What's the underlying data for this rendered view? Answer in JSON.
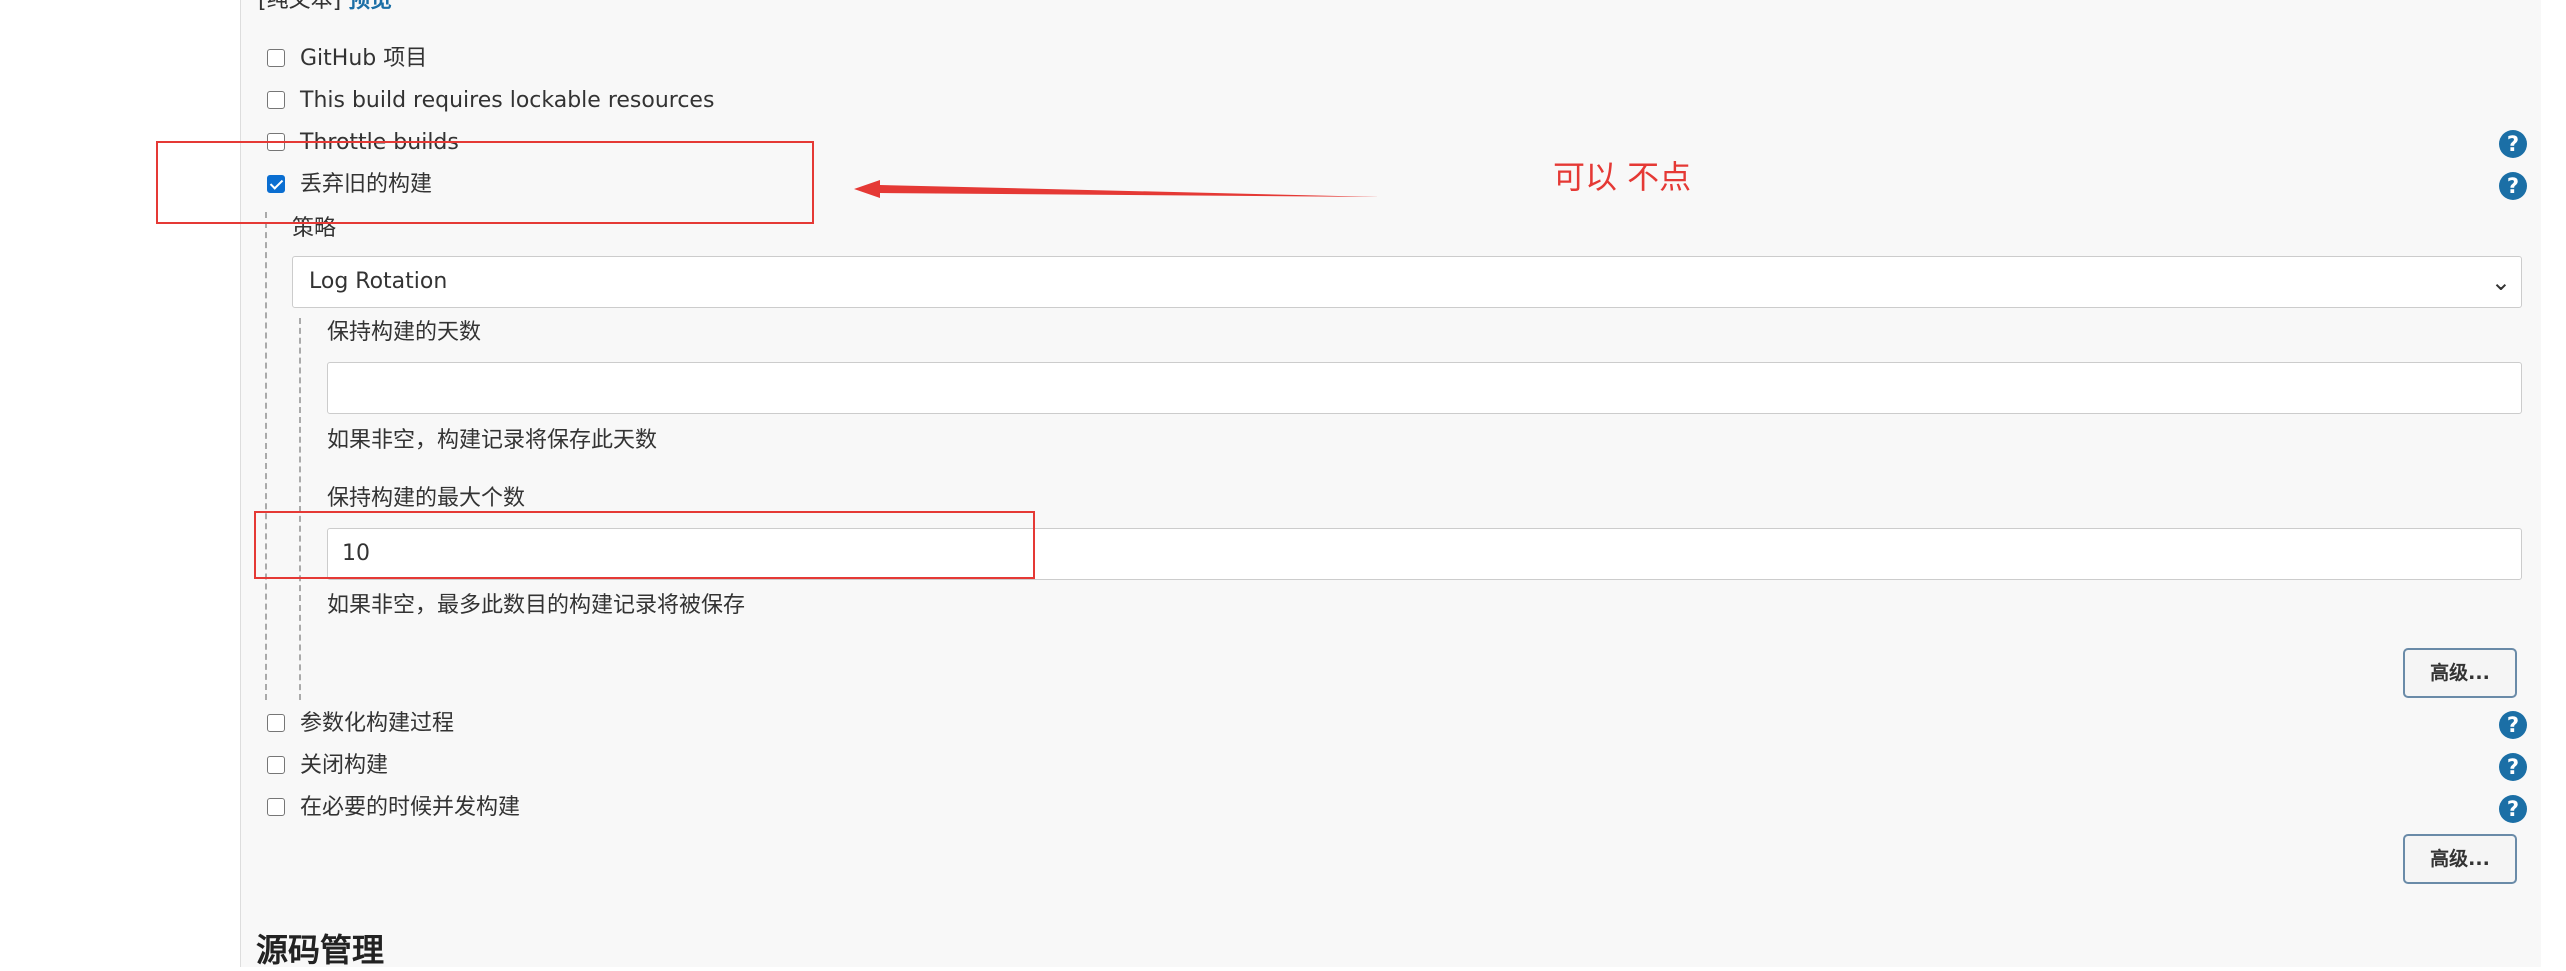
{
  "header": {
    "raw_text_label": "[纯文本]",
    "preview_link": "预览"
  },
  "options_top": [
    {
      "label": "GitHub 项目",
      "checked": false
    },
    {
      "label": "This build requires lockable resources",
      "checked": false
    },
    {
      "label": "Throttle builds",
      "checked": false
    },
    {
      "label": "丢弃旧的构建",
      "checked": true
    }
  ],
  "discard": {
    "strategy_label": "策略",
    "strategy_value": "Log Rotation",
    "days_label": "保持构建的天数",
    "days_value": "",
    "days_help": "如果非空，构建记录将保存此天数",
    "max_label": "保持构建的最大个数",
    "max_value": "10",
    "max_help": "如果非空，最多此数目的构建记录将被保存",
    "advanced_button": "高级..."
  },
  "options_bottom": [
    {
      "label": "参数化构建过程",
      "checked": false
    },
    {
      "label": "关闭构建",
      "checked": false
    },
    {
      "label": "在必要的时候并发构建",
      "checked": false
    }
  ],
  "advanced_button_2": "高级...",
  "section_title": "源码管理",
  "help_glyph": "?",
  "annotation": {
    "text": "可以 不点",
    "color": "#e53935"
  },
  "colors": {
    "accent": "#0a6ed1",
    "help_icon": "#1b6fa6",
    "annotation": "#e53935"
  }
}
